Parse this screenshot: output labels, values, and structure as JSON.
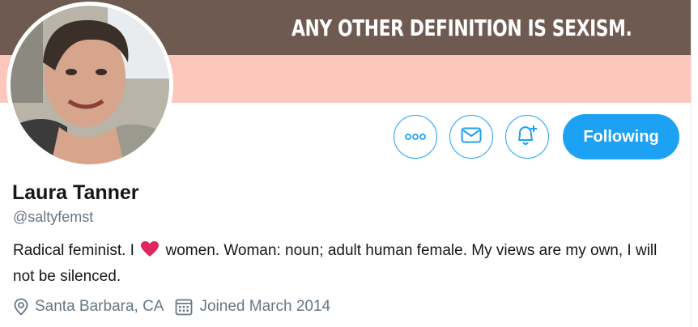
{
  "banner": {
    "text": "ANY OTHER DEFINITION IS SEXISM.",
    "top_color": "#6f5a52",
    "bottom_color": "#fbc6bc"
  },
  "profile": {
    "name": "Laura Tanner",
    "handle": "@saltyfemst",
    "bio_before_heart": "Radical feminist. I",
    "bio_heart_icon": "heart-emoji",
    "bio_after_heart": "women. Woman: noun; adult human female. My views are my own, I will not be silenced.",
    "location": "Santa Barbara, CA",
    "joined": "Joined March 2014"
  },
  "actions": {
    "more_icon": "more-dots-icon",
    "message_icon": "envelope-icon",
    "notify_icon": "bell-plus-icon",
    "follow_label": "Following"
  },
  "colors": {
    "accent": "#1da1f2",
    "secondary_text": "#657786",
    "heart": "#e0245e"
  }
}
